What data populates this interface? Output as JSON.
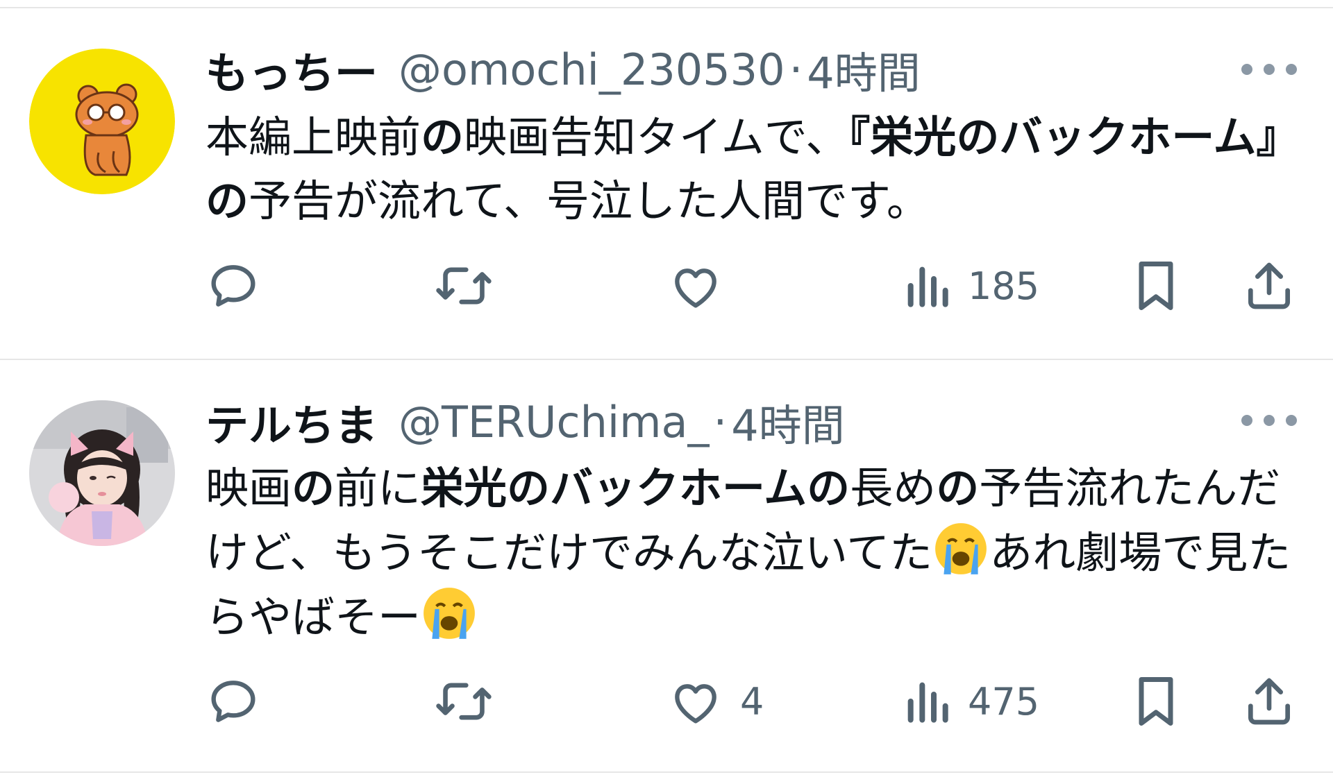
{
  "tweets": [
    {
      "name": "もっちー",
      "handle": "@omochi_230530",
      "separator": "·",
      "time": "4時間",
      "text_parts": [
        {
          "t": "本編上映前",
          "b": false
        },
        {
          "t": "の",
          "b": true
        },
        {
          "t": "映画告知タイムで、",
          "b": false
        },
        {
          "t": "『栄光のバックホーム』の",
          "b": true
        },
        {
          "t": "予告が流れて、号泣した人間です。",
          "b": false
        }
      ],
      "avatar_icon": "bear-avatar-icon",
      "avatar_bg": "#f7e300",
      "actions": {
        "reply_count": "",
        "retweet_count": "",
        "like_count": "",
        "views_count": "185"
      }
    },
    {
      "name": "テルちま",
      "handle": "@TERUchima_",
      "separator": "·",
      "time": "4時間",
      "text_parts": [
        {
          "t": "映画",
          "b": false
        },
        {
          "t": "の",
          "b": true
        },
        {
          "t": "前に",
          "b": false
        },
        {
          "t": "栄光のバックホームの",
          "b": true
        },
        {
          "t": "長め",
          "b": false
        },
        {
          "t": "の",
          "b": true
        },
        {
          "t": "予告流れたんだけど、もうそこだけでみんな泣いてた",
          "b": false
        },
        {
          "emoji": "crying-face"
        },
        {
          "t": "あれ劇場で見たらやばそー",
          "b": false
        },
        {
          "emoji": "crying-face"
        }
      ],
      "avatar_icon": "girl-photo-avatar",
      "actions": {
        "reply_count": "",
        "retweet_count": "",
        "like_count": "4",
        "views_count": "475"
      }
    }
  ],
  "icons": {
    "reply": "reply-icon",
    "retweet": "retweet-icon",
    "like": "heart-icon",
    "views": "views-icon",
    "bookmark": "bookmark-icon",
    "share": "share-icon",
    "more": "more-icon"
  },
  "colors": {
    "text": "#0f1419",
    "secondary": "#536471",
    "divider": "#e6e6e6"
  }
}
